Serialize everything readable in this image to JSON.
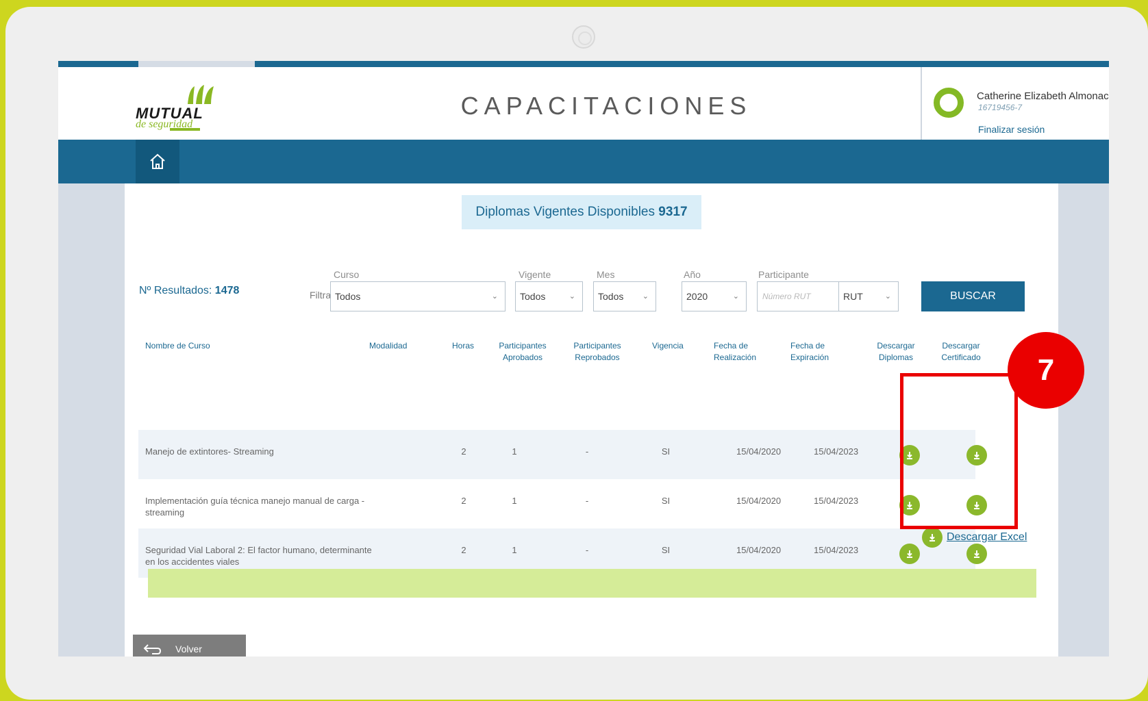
{
  "app": {
    "title": "CAPACITACIONES",
    "logo_word": "MUTUAL",
    "logo_sub": "de seguridad"
  },
  "user": {
    "name": "Catherine Elizabeth Almonac",
    "rut": "16719456-7",
    "logout_label": "Finalizar sesión"
  },
  "summary": {
    "available_label": "Diplomas Vigentes Disponibles",
    "available_count": "9317",
    "results_label": "Nº Resultados:",
    "results_count": "1478"
  },
  "filters": {
    "filter_label": "Filtrar:",
    "curso_label": "Curso",
    "curso_value": "Todos",
    "vigente_label": "Vigente",
    "vigente_value": "Todos",
    "mes_label": "Mes",
    "mes_value": "Todos",
    "anio_label": "Año",
    "anio_value": "2020",
    "participante_label": "Participante",
    "participante_placeholder": "Número RUT",
    "participante_type": "RUT",
    "search_label": "BUSCAR"
  },
  "table": {
    "columns": {
      "nombre": "Nombre de Curso",
      "modalidad": "Modalidad",
      "horas": "Horas",
      "aprobados": "Participantes\nAprobados",
      "reprobados": "Participantes\nReprobados",
      "vigencia": "Vigencia",
      "realizacion": "Fecha de\nRealización",
      "expiracion": "Fecha de\nExpiración",
      "diplomas": "Descargar\nDiplomas",
      "certificados": "Descargar\nCertificado"
    },
    "rows": [
      {
        "nombre": "Manejo de extintores- Streaming",
        "modalidad": "",
        "horas": "2",
        "aprobados": "1",
        "reprobados": "-",
        "vigencia": "SI",
        "realizacion": "15/04/2020",
        "expiracion": "15/04/2023"
      },
      {
        "nombre": "Implementación guía técnica manejo manual de carga -\nstreaming",
        "modalidad": "",
        "horas": "2",
        "aprobados": "1",
        "reprobados": "-",
        "vigencia": "SI",
        "realizacion": "15/04/2020",
        "expiracion": "15/04/2023"
      },
      {
        "nombre": "Seguridad Vial Laboral 2: El factor humano, determinante\nen los accidentes viales",
        "modalidad": "",
        "horas": "2",
        "aprobados": "1",
        "reprobados": "-",
        "vigencia": "SI",
        "realizacion": "15/04/2020",
        "expiracion": "15/04/2023"
      }
    ]
  },
  "actions": {
    "excel_label": "Descargar Excel",
    "back_label": "Volver"
  },
  "annotation": {
    "step": "7"
  },
  "colors": {
    "brand_blue": "#1b6891",
    "brand_green": "#8bb82c",
    "highlight_red": "#ea0000",
    "frame_yellow": "#cdd61f"
  }
}
